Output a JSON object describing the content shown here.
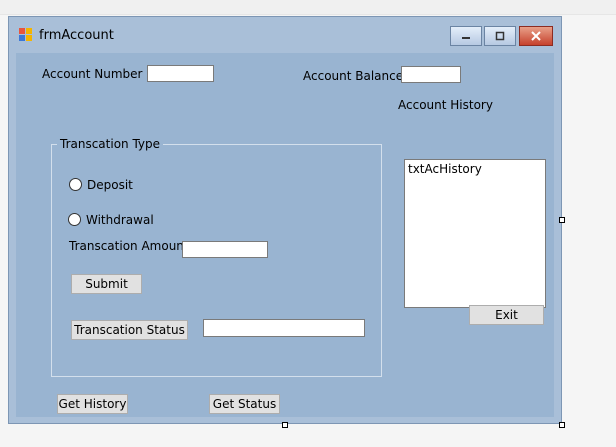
{
  "window": {
    "title": "frmAccount",
    "icon": "windows-form-icon",
    "controls": [
      "minimize-icon",
      "maximize-icon",
      "close-icon"
    ]
  },
  "account_number": {
    "label": "Account Number",
    "value": ""
  },
  "account_balance": {
    "label": "Account Balance",
    "value": ""
  },
  "account_history": {
    "label": "Account History",
    "value": "txtAcHistory"
  },
  "transaction_type": {
    "title": "Transcation Type",
    "options": [
      {
        "label": "Deposit",
        "checked": false
      },
      {
        "label": "Withdrawal",
        "checked": false
      }
    ]
  },
  "transaction_amount": {
    "label": "Transcation Amount",
    "value": ""
  },
  "buttons": {
    "submit": "Submit",
    "transaction_status": "Transcation Status",
    "exit": "Exit",
    "get_history": "Get History",
    "get_status": "Get Status"
  },
  "transaction_status_value": "",
  "colors": {
    "form_background": "#99b4d1",
    "window_frame": "#a9bfd8",
    "close_button": "#c6412c"
  }
}
